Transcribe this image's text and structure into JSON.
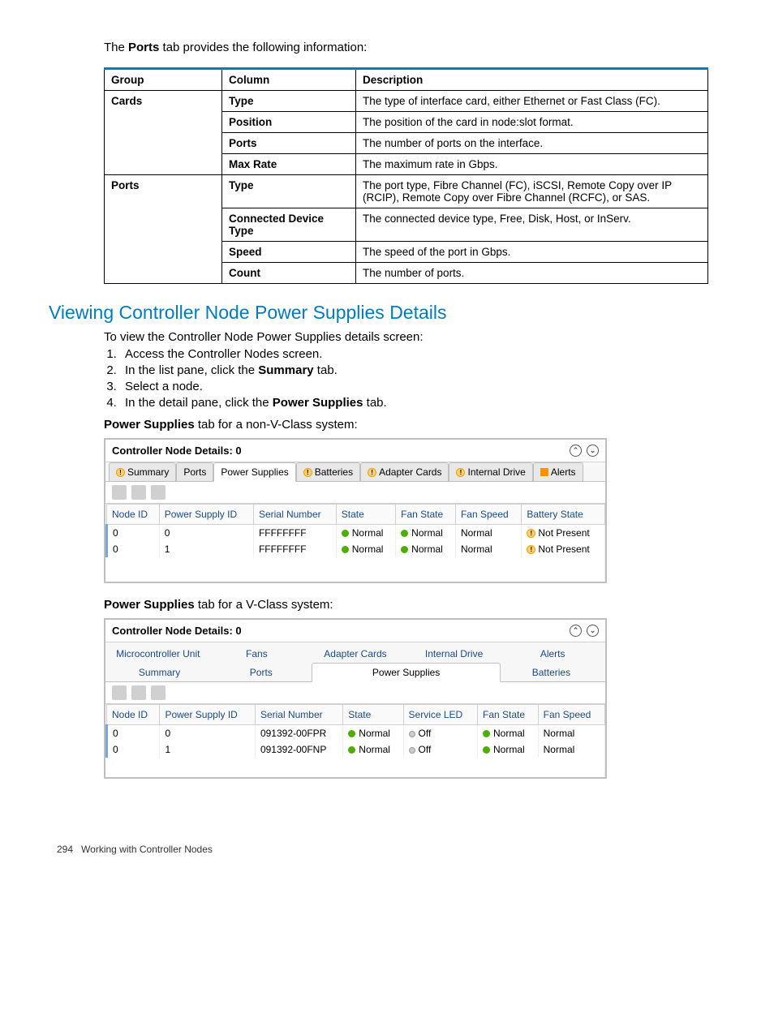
{
  "intro": {
    "pre": "The ",
    "bold": "Ports",
    "post": " tab provides the following information:"
  },
  "ports_table": {
    "headers": [
      "Group",
      "Column",
      "Description"
    ],
    "rows": [
      {
        "group": "Cards",
        "column": "Type",
        "desc": "The type of interface card, either Ethernet or Fast Class (FC)."
      },
      {
        "group": "",
        "column": "Position",
        "desc": "The position of the card in node:slot format."
      },
      {
        "group": "",
        "column": "Ports",
        "desc": "The number of ports on the interface."
      },
      {
        "group": "",
        "column": "Max Rate",
        "desc": "The maximum rate in Gbps."
      },
      {
        "group": "Ports",
        "column": "Type",
        "desc": "The port type, Fibre Channel (FC), iSCSI, Remote Copy over IP (RCIP), Remote Copy over Fibre Channel (RCFC), or SAS."
      },
      {
        "group": "",
        "column": "Connected Device Type",
        "desc": "The connected device type, Free, Disk, Host, or InServ."
      },
      {
        "group": "",
        "column": "Speed",
        "desc": "The speed of the port in Gbps."
      },
      {
        "group": "",
        "column": "Count",
        "desc": "The number of ports."
      }
    ]
  },
  "section_heading": "Viewing Controller Node Power Supplies Details",
  "body_text": "To view the Controller Node Power Supplies details screen:",
  "steps": [
    {
      "text": "Access the Controller Nodes screen."
    },
    {
      "pre": "In the list pane, click the ",
      "bold": "Summary",
      "post": " tab."
    },
    {
      "text": "Select a node."
    },
    {
      "pre": "In the detail pane, click the ",
      "bold": "Power Supplies",
      "post": " tab."
    }
  ],
  "caption1": {
    "bold": "Power Supplies",
    "post": " tab for a non-V-Class system:"
  },
  "panel1": {
    "title": "Controller Node Details: 0",
    "tabs": [
      "Summary",
      "Ports",
      "Power Supplies",
      "Batteries",
      "Adapter Cards",
      "Internal Drive",
      "Alerts"
    ],
    "columns": [
      "Node ID",
      "Power Supply ID",
      "Serial Number",
      "State",
      "Fan State",
      "Fan Speed",
      "Battery State"
    ],
    "rows": [
      {
        "node": "0",
        "ps": "0",
        "serial": "FFFFFFFF",
        "state": "Normal",
        "fanstate": "Normal",
        "fanspeed": "Normal",
        "battery": "Not Present"
      },
      {
        "node": "0",
        "ps": "1",
        "serial": "FFFFFFFF",
        "state": "Normal",
        "fanstate": "Normal",
        "fanspeed": "Normal",
        "battery": "Not Present"
      }
    ]
  },
  "caption2": {
    "bold": "Power Supplies",
    "post": " tab for a V-Class system:"
  },
  "panel2": {
    "title": "Controller Node Details: 0",
    "tabs_row1": [
      "Microcontroller Unit",
      "Fans",
      "Adapter Cards",
      "Internal Drive",
      "Alerts"
    ],
    "tabs_row2": [
      "Summary",
      "Ports",
      "Power Supplies",
      "Batteries"
    ],
    "columns": [
      "Node ID",
      "Power Supply ID",
      "Serial Number",
      "State",
      "Service LED",
      "Fan State",
      "Fan Speed"
    ],
    "rows": [
      {
        "node": "0",
        "ps": "0",
        "serial": "091392-00FPR",
        "state": "Normal",
        "led": "Off",
        "fanstate": "Normal",
        "fanspeed": "Normal"
      },
      {
        "node": "0",
        "ps": "1",
        "serial": "091392-00FNP",
        "state": "Normal",
        "led": "Off",
        "fanstate": "Normal",
        "fanspeed": "Normal"
      }
    ]
  },
  "footer": {
    "page": "294",
    "title": "Working with Controller Nodes"
  }
}
